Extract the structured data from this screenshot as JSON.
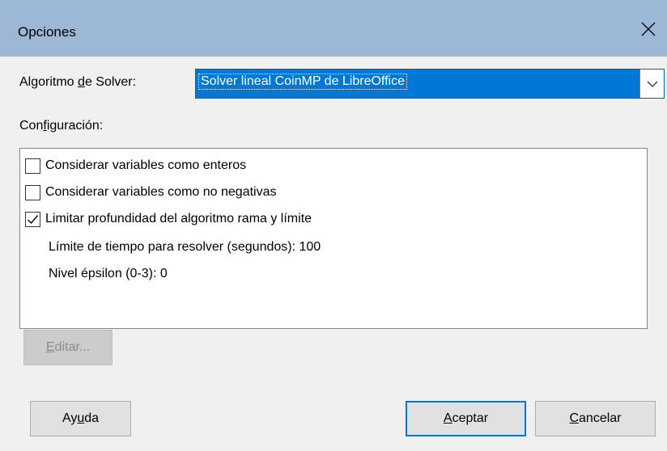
{
  "window": {
    "title": "Opciones"
  },
  "algorithm": {
    "label_pre": "Algoritmo ",
    "label_u": "d",
    "label_post": "e Solver:",
    "selected": "Solver lineal CoinMP de LibreOffice"
  },
  "config": {
    "label_pre": "Con",
    "label_u": "f",
    "label_post": "iguración:",
    "options": [
      {
        "label": "Considerar variables como enteros",
        "checked": false
      },
      {
        "label": "Considerar variables como no negativas",
        "checked": false
      },
      {
        "label": "Limitar profundidad del algoritmo rama y límite",
        "checked": true
      }
    ],
    "settings": [
      "Límite de tiempo para resolver (segundos): 100",
      "Nivel épsilon (0-3): 0"
    ]
  },
  "buttons": {
    "edit_u": "E",
    "edit_post": "ditar...",
    "help_pre": "Ay",
    "help_u": "u",
    "help_post": "da",
    "ok_u": "A",
    "ok_post": "ceptar",
    "cancel_u": "C",
    "cancel_post": "ancelar"
  },
  "colors": {
    "titlebar": "#9cb8d6",
    "accent": "#0078d7"
  },
  "icons": {
    "close": "close-icon",
    "dropdown": "chevron-down-icon",
    "check": "check-icon"
  }
}
